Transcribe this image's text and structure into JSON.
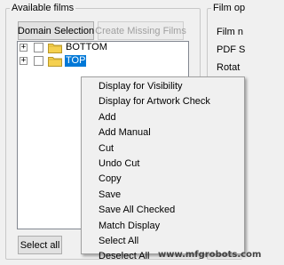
{
  "films_group": {
    "title": "Available films",
    "domain_selection_label": "Domain Selection",
    "create_missing_label": "Create Missing Films",
    "select_all_label": "Select all"
  },
  "tree": {
    "items": [
      {
        "label": "BOTTOM",
        "expander": "+",
        "checked": false,
        "selected": false
      },
      {
        "label": "TOP",
        "expander": "+",
        "checked": false,
        "selected": true
      }
    ]
  },
  "options_group": {
    "title": "Film op",
    "labels": [
      "Film n",
      "PDF S",
      "Rotat"
    ]
  },
  "context_menu": {
    "items": [
      "Display for Visibility",
      "Display for Artwork Check",
      "Add",
      "Add Manual",
      "Cut",
      "Undo Cut",
      "Copy",
      "Save",
      "Save All Checked",
      "Match Display",
      "Select All",
      "Deselect All"
    ]
  },
  "watermark": "www.mfgrobots.com",
  "colors": {
    "selection": "#0078d7",
    "folder": "#f5d04f",
    "window_bg": "#f0f0f0"
  }
}
